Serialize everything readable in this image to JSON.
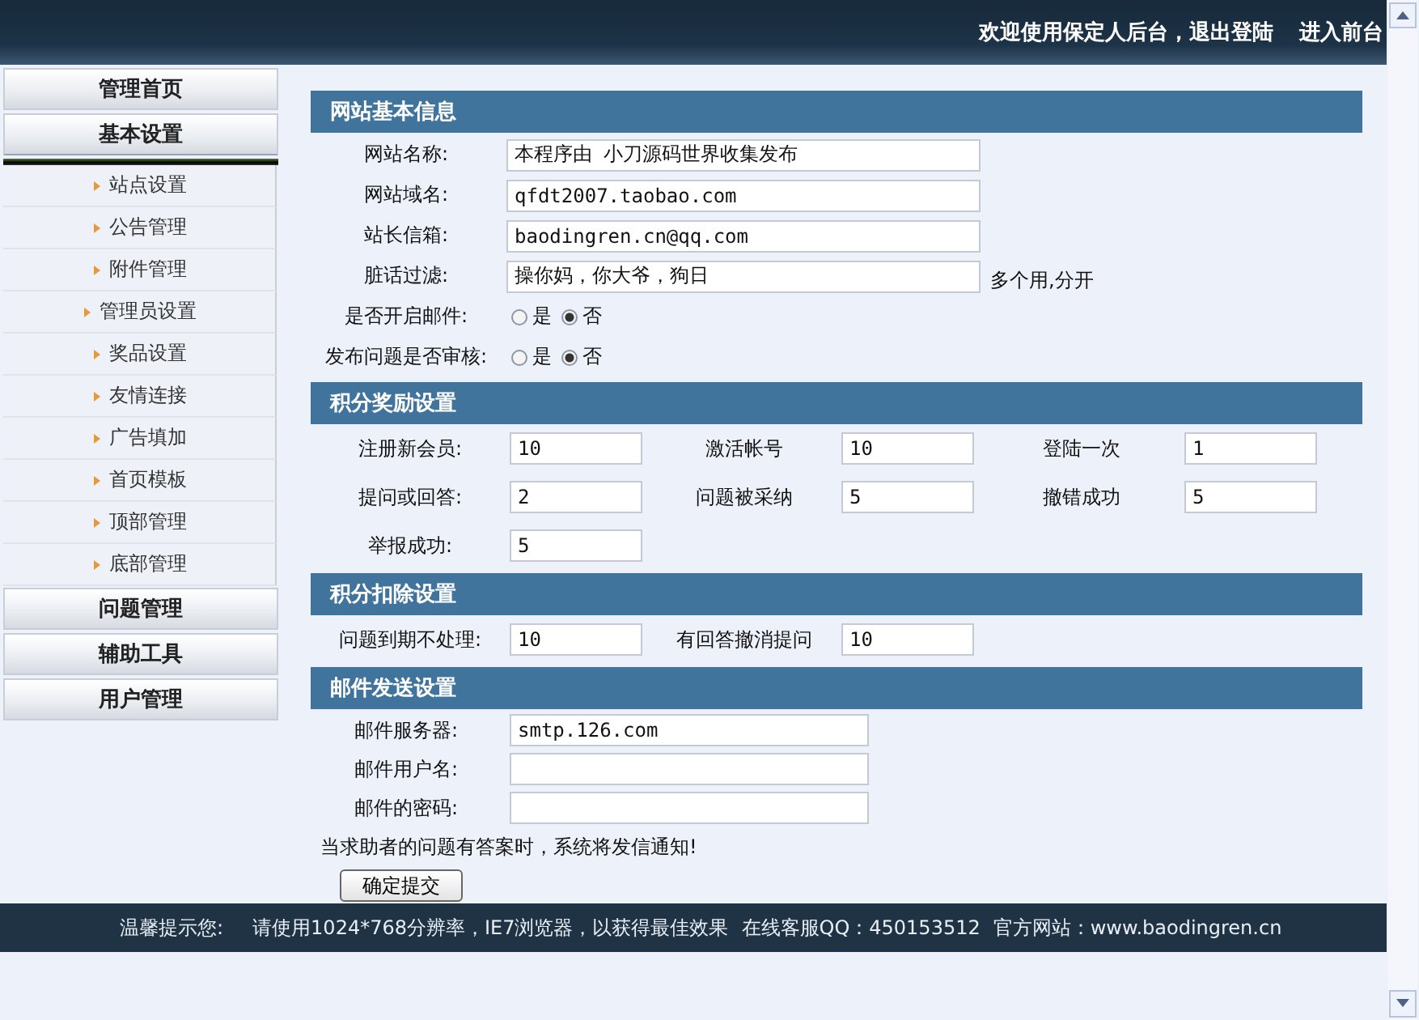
{
  "header": {
    "welcome": "欢迎使用保定人后台，",
    "links": [
      "退出登陆",
      "进入前台"
    ]
  },
  "sidebar": {
    "sections": [
      {
        "label": "管理首页",
        "expanded": false
      },
      {
        "label": "基本设置",
        "expanded": true,
        "children": [
          {
            "label": "站点设置"
          },
          {
            "label": "公告管理"
          },
          {
            "label": "附件管理"
          },
          {
            "label": "管理员设置"
          },
          {
            "label": "奖品设置"
          },
          {
            "label": "友情连接"
          },
          {
            "label": "广告填加"
          },
          {
            "label": "首页模板"
          },
          {
            "label": "顶部管理"
          },
          {
            "label": "底部管理"
          }
        ]
      },
      {
        "label": "问题管理",
        "expanded": false
      },
      {
        "label": "辅助工具",
        "expanded": false
      },
      {
        "label": "用户管理",
        "expanded": false
      }
    ]
  },
  "sections": [
    {
      "title": "网站基本信息",
      "kind": "wide",
      "fields": [
        {
          "kind": "text",
          "label": "网站名称:",
          "value": "本程序由 小刀源码世界收集发布"
        },
        {
          "kind": "text",
          "label": "网站域名:",
          "value": "qfdt2007.taobao.com"
        },
        {
          "kind": "text",
          "label": "站长信箱:",
          "value": "baodingren.cn@qq.com"
        },
        {
          "kind": "text",
          "label": "脏话过滤:",
          "value": "操你妈，你大爷，狗日",
          "hint": "多个用,分开"
        },
        {
          "kind": "radio",
          "label": "是否开启邮件:",
          "options": [
            {
              "label": "是",
              "selected": false
            },
            {
              "label": "否",
              "selected": true
            }
          ]
        },
        {
          "kind": "radio",
          "label": "发布问题是否审核:",
          "options": [
            {
              "label": "是",
              "selected": false
            },
            {
              "label": "否",
              "selected": true
            }
          ]
        }
      ]
    },
    {
      "title": "积分奖励设置",
      "kind": "grid",
      "fields": [
        {
          "kind": "text",
          "label": "注册新会员:",
          "value": "10"
        },
        {
          "kind": "text",
          "label": "激活帐号",
          "value": "10"
        },
        {
          "kind": "text",
          "label": "登陆一次",
          "value": "1"
        },
        {
          "kind": "text",
          "label": "提问或回答:",
          "value": "2"
        },
        {
          "kind": "text",
          "label": "问题被采纳",
          "value": "5"
        },
        {
          "kind": "text",
          "label": "撤错成功",
          "value": "5"
        },
        {
          "kind": "text",
          "label": "举报成功:",
          "value": "5"
        }
      ]
    },
    {
      "title": "积分扣除设置",
      "kind": "grid",
      "fields": [
        {
          "kind": "text",
          "label": "问题到期不处理:",
          "value": "10"
        },
        {
          "kind": "text",
          "label": "有回答撤消提问",
          "value": "10"
        }
      ]
    },
    {
      "title": "邮件发送设置",
      "kind": "narrow",
      "fields": [
        {
          "kind": "text",
          "label": "邮件服务器:",
          "value": "smtp.126.com"
        },
        {
          "kind": "text",
          "label": "邮件用户名:"
        },
        {
          "kind": "text",
          "label": "邮件的密码:"
        }
      ],
      "note": "当求助者的问题有答案时，系统将发信通知!",
      "button": "确定提交"
    }
  ],
  "footer": {
    "label": "温馨提示您:",
    "items": [
      "请使用1024*768分辨率，IE7浏览器，以获得最佳效果",
      "在线客服QQ：450153512",
      "官方网站：www.baodingren.cn"
    ]
  }
}
